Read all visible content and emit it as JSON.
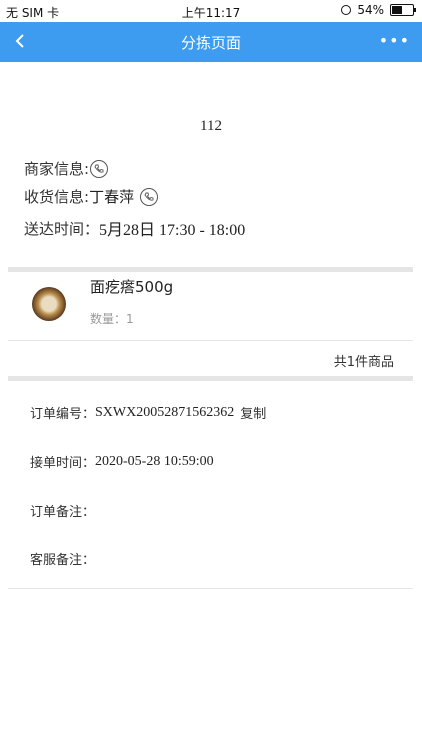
{
  "statusbar": {
    "carrier": "无 SIM 卡",
    "time": "上午11:17",
    "battery": "54%",
    "battery_level": 0.54
  },
  "navbar": {
    "title": "分拣页面",
    "more": "•••"
  },
  "order": {
    "number": "112",
    "merchant_label": "商家信息:",
    "receiver_label": "收货信息:",
    "receiver_name": "丁春萍",
    "delivery_label": "送达时间：",
    "delivery_time": "5月28日 17:30 - 18:00"
  },
  "product": {
    "name": "面疙瘩500g",
    "qty": "数量：1"
  },
  "summary": {
    "total": "共1件商品"
  },
  "details": {
    "order_id_label": "订单编号：",
    "order_id": "SXWX20052871562362",
    "copy": "复制",
    "accept_label": "接单时间：",
    "accept_time": "2020-05-28 10:59:00",
    "order_note_label": "订单备注：",
    "service_note_label": "客服备注："
  }
}
